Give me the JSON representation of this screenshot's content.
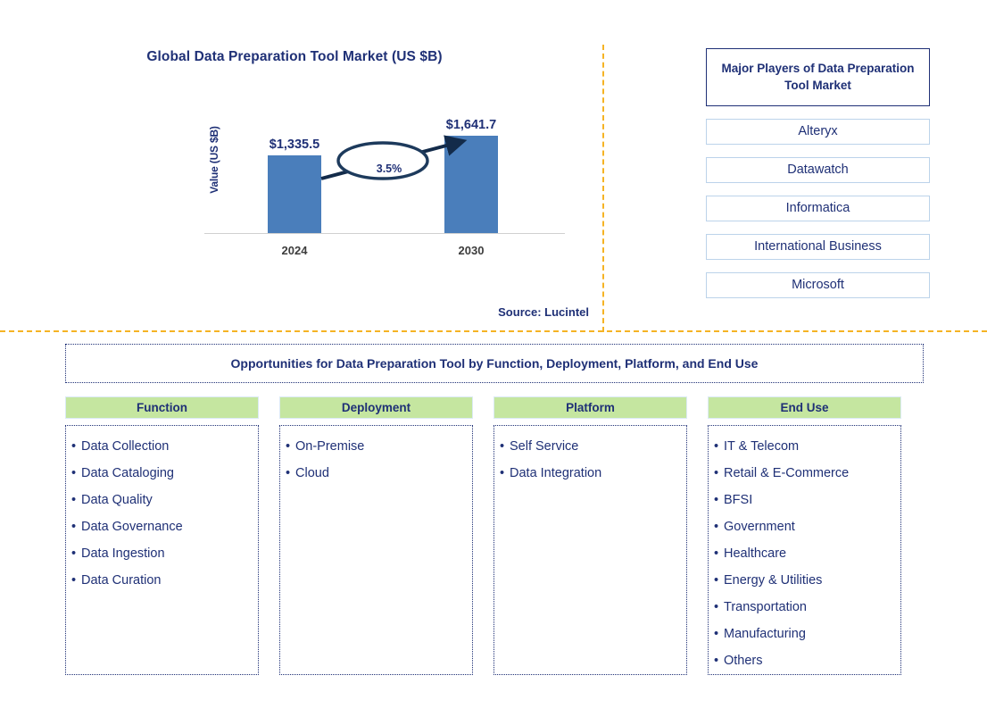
{
  "chart_panel": {
    "title": "Global Data Preparation Tool Market (US $B)",
    "source": "Source: Lucintel"
  },
  "chart_data": {
    "type": "bar",
    "title": "Global Data Preparation Tool Market (US $B)",
    "xlabel": "",
    "ylabel": "Value (US $B)",
    "categories": [
      "2024",
      "2030"
    ],
    "values": [
      1335.5,
      1641.7
    ],
    "value_labels": [
      "$1,335.5",
      "$1,641.7"
    ],
    "ylim": [
      0,
      1800
    ],
    "grid": false,
    "legend": "none",
    "annotation": {
      "cagr_label": "3.5%",
      "description": "Arrow from 2024 bar to 2030 bar with CAGR callout oval"
    },
    "bar_color": "#4a7ebb",
    "text_color": "#1f3076",
    "tick_color": "#3d3d3d"
  },
  "players_panel": {
    "heading": "Major Players of Data Preparation Tool Market",
    "items": [
      "Alteryx",
      "Datawatch",
      "Informatica",
      "International Business",
      "Microsoft"
    ]
  },
  "opportunities": {
    "banner": "Opportunities for Data Preparation Tool by Function, Deployment, Platform, and End Use",
    "columns": [
      {
        "header": "Function",
        "items": [
          "Data Collection",
          "Data Cataloging",
          "Data Quality",
          "Data Governance",
          "Data Ingestion",
          "Data Curation"
        ]
      },
      {
        "header": "Deployment",
        "items": [
          "On-Premise",
          "Cloud"
        ]
      },
      {
        "header": "Platform",
        "items": [
          "Self Service",
          "Data Integration"
        ]
      },
      {
        "header": "End Use",
        "items": [
          "IT & Telecom",
          "Retail & E-Commerce",
          "BFSI",
          "Government",
          "Healthcare",
          "Energy & Utilities",
          "Transportation",
          "Manufacturing",
          "Others"
        ]
      }
    ]
  },
  "colors": {
    "navy": "#1f3076",
    "bar_blue": "#4a7ebb",
    "header_green": "#c5e6a0",
    "divider_orange": "#f5b324",
    "box_border_blue": "#bcd3ea"
  },
  "bullet_glyph": "•"
}
